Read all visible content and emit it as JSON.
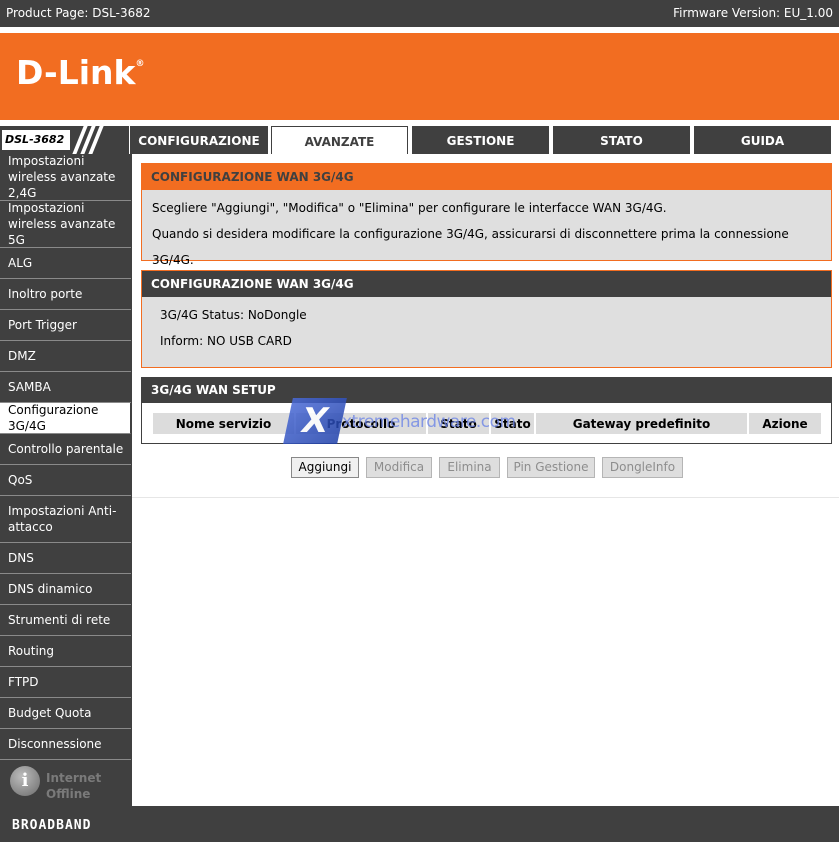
{
  "topbar": {
    "product": "Product Page: DSL-3682",
    "firmware": "Firmware Version: EU_1.00"
  },
  "brand": {
    "logo": "D-Link",
    "reg": "®",
    "footer": "BROADBAND"
  },
  "model": "DSL-3682",
  "tabs": [
    {
      "label": "CONFIGURAZIONE"
    },
    {
      "label": "AVANZATE"
    },
    {
      "label": "GESTIONE"
    },
    {
      "label": "STATO"
    },
    {
      "label": "GUIDA"
    }
  ],
  "sidebar": {
    "items": [
      {
        "label": "Impostazioni wireless avanzate 2,4G"
      },
      {
        "label": "Impostazioni wireless avanzate 5G"
      },
      {
        "label": "ALG"
      },
      {
        "label": "Inoltro porte"
      },
      {
        "label": "Port Trigger"
      },
      {
        "label": "DMZ"
      },
      {
        "label": "SAMBA"
      },
      {
        "label": "Configurazione 3G/4G"
      },
      {
        "label": "Controllo parentale"
      },
      {
        "label": "QoS"
      },
      {
        "label": "Impostazioni Anti-attacco"
      },
      {
        "label": "DNS"
      },
      {
        "label": "DNS dinamico"
      },
      {
        "label": "Strumenti di rete"
      },
      {
        "label": "Routing"
      },
      {
        "label": "FTPD"
      },
      {
        "label": "Budget Quota"
      },
      {
        "label": "Disconnessione"
      }
    ],
    "internet_status": "Internet Offline"
  },
  "section1": {
    "title": "CONFIGURAZIONE WAN 3G/4G",
    "line1": "Scegliere \"Aggiungi\", \"Modifica\" o \"Elimina\" per configurare le interfacce WAN 3G/4G.",
    "line2": "Quando si desidera modificare la configurazione 3G/4G, assicurarsi di disconnettere prima la connessione 3G/4G."
  },
  "section2": {
    "title": "CONFIGURAZIONE WAN 3G/4G",
    "status": "3G/4G Status: NoDongle",
    "inform": "Inform: NO USB CARD"
  },
  "section3": {
    "title": "3G/4G WAN SETUP",
    "columns": [
      "Nome servizio",
      "Protocollo",
      "Stato",
      "Stato",
      "Gateway predefinito",
      "Azione"
    ]
  },
  "buttons": {
    "add": "Aggiungi",
    "modify": "Modifica",
    "delete": "Elimina",
    "pin": "Pin Gestione",
    "dongle": "DongleInfo"
  },
  "watermark": {
    "text": "xtremehardware.com",
    "glyph": "X"
  },
  "colors": {
    "accent": "#f26d21",
    "dark": "#404040"
  }
}
